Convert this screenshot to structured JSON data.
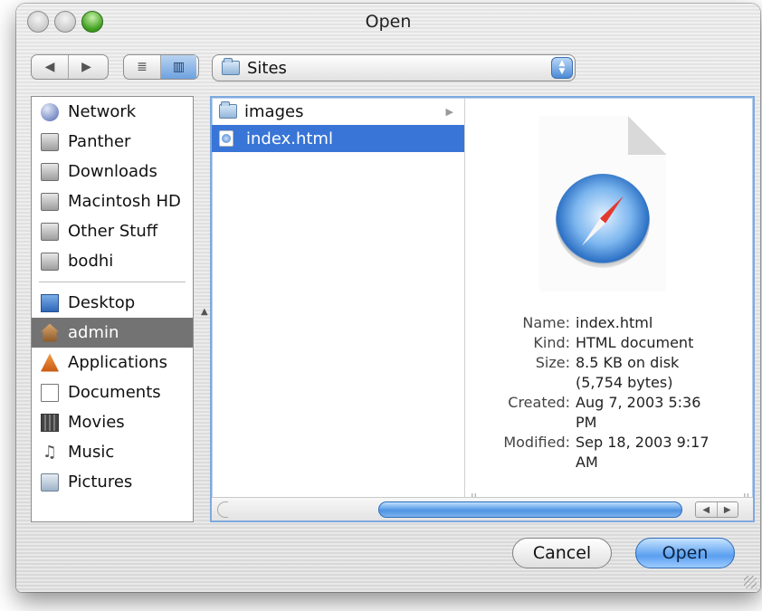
{
  "window": {
    "title": "Open"
  },
  "toolbar": {
    "back": "◀",
    "forward": "▶",
    "list_view": "≣",
    "column_view": "▥",
    "location": "Sites"
  },
  "sidebar": {
    "devices": [
      {
        "label": "Network",
        "icon": "network-globe-icon"
      },
      {
        "label": "Panther",
        "icon": "hard-disk-icon"
      },
      {
        "label": "Downloads",
        "icon": "hard-disk-icon"
      },
      {
        "label": "Macintosh HD",
        "icon": "hard-disk-icon"
      },
      {
        "label": "Other Stuff",
        "icon": "hard-disk-icon"
      },
      {
        "label": "bodhi",
        "icon": "hard-disk-icon"
      }
    ],
    "places": [
      {
        "label": "Desktop",
        "icon": "desktop-icon"
      },
      {
        "label": "admin",
        "icon": "home-icon",
        "selected": true
      },
      {
        "label": "Applications",
        "icon": "applications-icon"
      },
      {
        "label": "Documents",
        "icon": "documents-icon"
      },
      {
        "label": "Movies",
        "icon": "movies-icon"
      },
      {
        "label": "Music",
        "icon": "music-icon"
      },
      {
        "label": "Pictures",
        "icon": "pictures-icon"
      }
    ]
  },
  "browser": {
    "items": [
      {
        "label": "images",
        "type": "folder",
        "arrow": "▶"
      },
      {
        "label": "index.html",
        "type": "html",
        "selected": true
      }
    ],
    "preview": {
      "rows": [
        {
          "key": "Name:",
          "value": "index.html"
        },
        {
          "key": "Kind:",
          "value": "HTML document"
        },
        {
          "key": "Size:",
          "value": "8.5 KB on disk (5,754 bytes)"
        },
        {
          "key": "Created:",
          "value": "Aug 7, 2003 5:36 PM"
        },
        {
          "key": "Modified:",
          "value": "Sep 18, 2003 9:17 AM"
        }
      ]
    },
    "resize_glyph": "II",
    "scroll_left": "◀",
    "scroll_right": "▶"
  },
  "buttons": {
    "cancel": "Cancel",
    "open": "Open"
  },
  "colors": {
    "selection": "#3875d7",
    "sidebar_selected": "#737373",
    "accent_blue": "#5a9ff0"
  }
}
